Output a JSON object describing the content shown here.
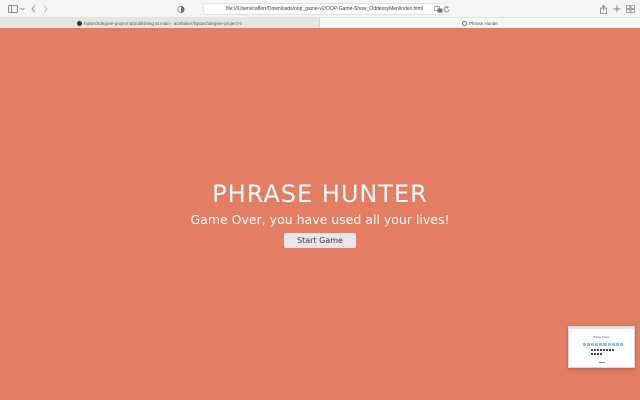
{
  "browser": {
    "url": "file:///Users/cafferr/Downloads/oop_game-v2/OOP-Game-Show_OddessyMen/index.html",
    "tabs": [
      {
        "label": "fsjstechdegree-project-5/publishing at main · acnbaker/fsjstechdegree-project-5",
        "active": false,
        "icon": "github-icon"
      },
      {
        "label": "Phrase Hunter",
        "active": true,
        "icon": "globe-icon"
      }
    ]
  },
  "page": {
    "title": "PHRASE HUNTER",
    "message": "Game Over, you have used all your lives!",
    "start_button": "Start Game",
    "background_color": "#e37d63"
  },
  "thumbnail": {
    "title": "Phrase Hunter"
  }
}
